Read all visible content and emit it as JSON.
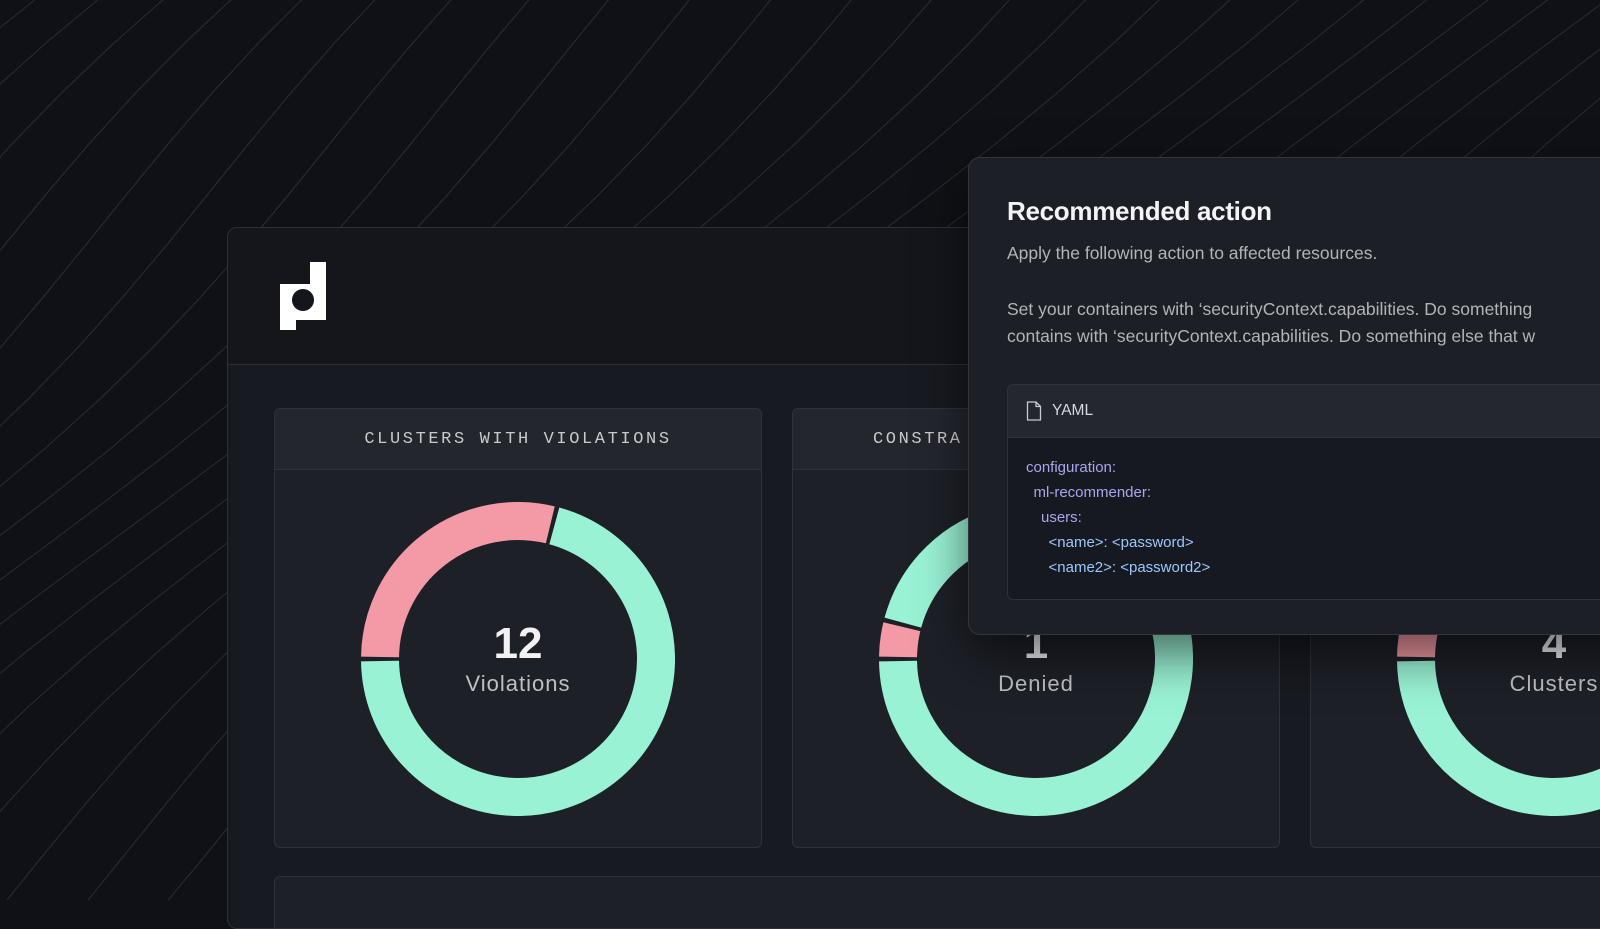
{
  "dashboard": {
    "cards": [
      {
        "header": "CLUSTERS WITH VIOLATIONS",
        "value": "12",
        "label": "Violations",
        "segments": [
          {
            "status": "violation",
            "fraction": 0.29
          },
          {
            "status": "ok",
            "fraction": 0.71
          }
        ]
      },
      {
        "header": "CONSTRA",
        "value": "1",
        "label": "Denied",
        "segments": [
          {
            "status": "violation",
            "fraction": 0.04
          },
          {
            "status": "ok",
            "fraction": 0.96
          }
        ]
      },
      {
        "header": "",
        "value": "4",
        "label": "Clusters",
        "segments": [
          {
            "status": "violation",
            "fraction": 0.04
          },
          {
            "status": "ok",
            "fraction": 0.96
          }
        ]
      }
    ]
  },
  "popup": {
    "title": "Recommended action",
    "subtitle": "Apply the following action to affected resources.",
    "description_lines": [
      "Set your containers with ‘securityContext.capabilities. Do something",
      "contains with ‘securityContext.capabilities. Do something else that w"
    ],
    "code": {
      "language": "YAML",
      "lines": [
        {
          "text": "configuration:",
          "indent": 0,
          "kind": "key"
        },
        {
          "text": "ml-recommender:",
          "indent": 1,
          "kind": "key"
        },
        {
          "text": "users:",
          "indent": 2,
          "kind": "key"
        },
        {
          "text": "<name>: <password>",
          "indent": 3,
          "kind": "value"
        },
        {
          "text": "<name2>: <password2>",
          "indent": 3,
          "kind": "value"
        }
      ]
    }
  },
  "colors": {
    "violation": "#f49aa6",
    "ok": "#9af2d4",
    "background": "#0f1116",
    "card": "#1e2028",
    "popup": "#1d1f26"
  },
  "icons": {
    "logo": "brand-logo-icon",
    "file": "file-icon"
  }
}
